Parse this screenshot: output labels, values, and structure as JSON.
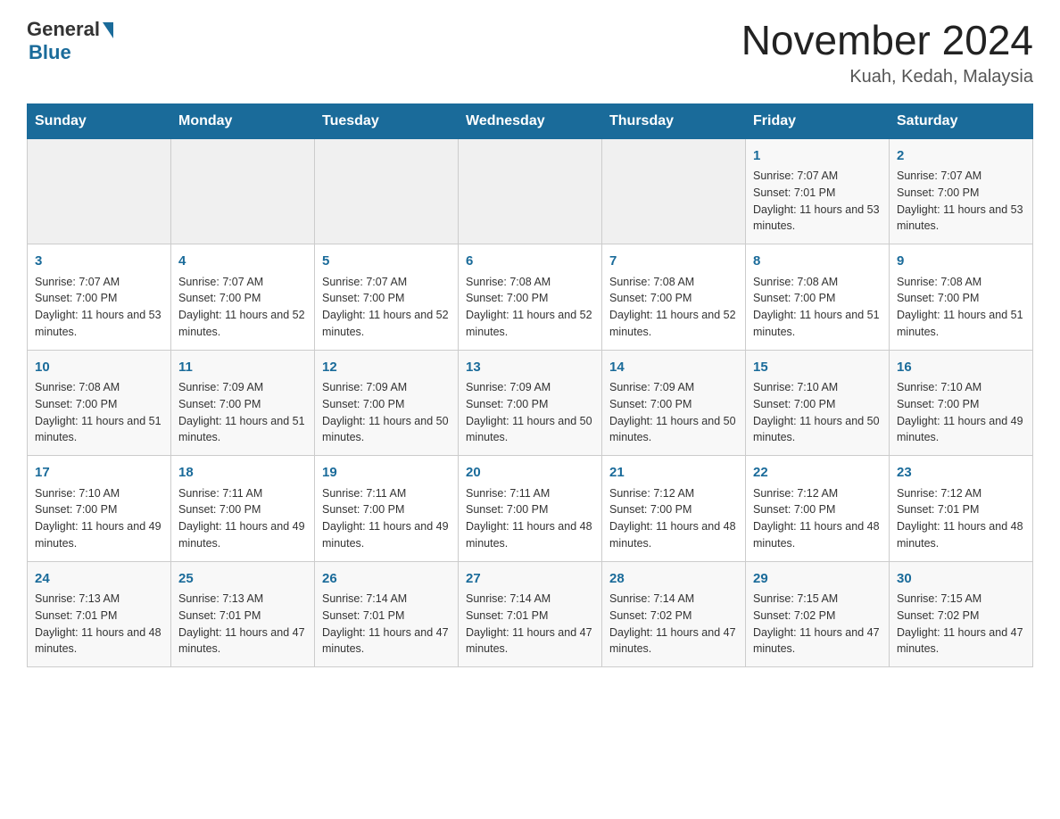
{
  "header": {
    "logo_general": "General",
    "logo_blue": "Blue",
    "month_title": "November 2024",
    "location": "Kuah, Kedah, Malaysia"
  },
  "days_of_week": [
    "Sunday",
    "Monday",
    "Tuesday",
    "Wednesday",
    "Thursday",
    "Friday",
    "Saturday"
  ],
  "weeks": [
    [
      {
        "day": "",
        "sunrise": "",
        "sunset": "",
        "daylight": ""
      },
      {
        "day": "",
        "sunrise": "",
        "sunset": "",
        "daylight": ""
      },
      {
        "day": "",
        "sunrise": "",
        "sunset": "",
        "daylight": ""
      },
      {
        "day": "",
        "sunrise": "",
        "sunset": "",
        "daylight": ""
      },
      {
        "day": "",
        "sunrise": "",
        "sunset": "",
        "daylight": ""
      },
      {
        "day": "1",
        "sunrise": "Sunrise: 7:07 AM",
        "sunset": "Sunset: 7:01 PM",
        "daylight": "Daylight: 11 hours and 53 minutes."
      },
      {
        "day": "2",
        "sunrise": "Sunrise: 7:07 AM",
        "sunset": "Sunset: 7:00 PM",
        "daylight": "Daylight: 11 hours and 53 minutes."
      }
    ],
    [
      {
        "day": "3",
        "sunrise": "Sunrise: 7:07 AM",
        "sunset": "Sunset: 7:00 PM",
        "daylight": "Daylight: 11 hours and 53 minutes."
      },
      {
        "day": "4",
        "sunrise": "Sunrise: 7:07 AM",
        "sunset": "Sunset: 7:00 PM",
        "daylight": "Daylight: 11 hours and 52 minutes."
      },
      {
        "day": "5",
        "sunrise": "Sunrise: 7:07 AM",
        "sunset": "Sunset: 7:00 PM",
        "daylight": "Daylight: 11 hours and 52 minutes."
      },
      {
        "day": "6",
        "sunrise": "Sunrise: 7:08 AM",
        "sunset": "Sunset: 7:00 PM",
        "daylight": "Daylight: 11 hours and 52 minutes."
      },
      {
        "day": "7",
        "sunrise": "Sunrise: 7:08 AM",
        "sunset": "Sunset: 7:00 PM",
        "daylight": "Daylight: 11 hours and 52 minutes."
      },
      {
        "day": "8",
        "sunrise": "Sunrise: 7:08 AM",
        "sunset": "Sunset: 7:00 PM",
        "daylight": "Daylight: 11 hours and 51 minutes."
      },
      {
        "day": "9",
        "sunrise": "Sunrise: 7:08 AM",
        "sunset": "Sunset: 7:00 PM",
        "daylight": "Daylight: 11 hours and 51 minutes."
      }
    ],
    [
      {
        "day": "10",
        "sunrise": "Sunrise: 7:08 AM",
        "sunset": "Sunset: 7:00 PM",
        "daylight": "Daylight: 11 hours and 51 minutes."
      },
      {
        "day": "11",
        "sunrise": "Sunrise: 7:09 AM",
        "sunset": "Sunset: 7:00 PM",
        "daylight": "Daylight: 11 hours and 51 minutes."
      },
      {
        "day": "12",
        "sunrise": "Sunrise: 7:09 AM",
        "sunset": "Sunset: 7:00 PM",
        "daylight": "Daylight: 11 hours and 50 minutes."
      },
      {
        "day": "13",
        "sunrise": "Sunrise: 7:09 AM",
        "sunset": "Sunset: 7:00 PM",
        "daylight": "Daylight: 11 hours and 50 minutes."
      },
      {
        "day": "14",
        "sunrise": "Sunrise: 7:09 AM",
        "sunset": "Sunset: 7:00 PM",
        "daylight": "Daylight: 11 hours and 50 minutes."
      },
      {
        "day": "15",
        "sunrise": "Sunrise: 7:10 AM",
        "sunset": "Sunset: 7:00 PM",
        "daylight": "Daylight: 11 hours and 50 minutes."
      },
      {
        "day": "16",
        "sunrise": "Sunrise: 7:10 AM",
        "sunset": "Sunset: 7:00 PM",
        "daylight": "Daylight: 11 hours and 49 minutes."
      }
    ],
    [
      {
        "day": "17",
        "sunrise": "Sunrise: 7:10 AM",
        "sunset": "Sunset: 7:00 PM",
        "daylight": "Daylight: 11 hours and 49 minutes."
      },
      {
        "day": "18",
        "sunrise": "Sunrise: 7:11 AM",
        "sunset": "Sunset: 7:00 PM",
        "daylight": "Daylight: 11 hours and 49 minutes."
      },
      {
        "day": "19",
        "sunrise": "Sunrise: 7:11 AM",
        "sunset": "Sunset: 7:00 PM",
        "daylight": "Daylight: 11 hours and 49 minutes."
      },
      {
        "day": "20",
        "sunrise": "Sunrise: 7:11 AM",
        "sunset": "Sunset: 7:00 PM",
        "daylight": "Daylight: 11 hours and 48 minutes."
      },
      {
        "day": "21",
        "sunrise": "Sunrise: 7:12 AM",
        "sunset": "Sunset: 7:00 PM",
        "daylight": "Daylight: 11 hours and 48 minutes."
      },
      {
        "day": "22",
        "sunrise": "Sunrise: 7:12 AM",
        "sunset": "Sunset: 7:00 PM",
        "daylight": "Daylight: 11 hours and 48 minutes."
      },
      {
        "day": "23",
        "sunrise": "Sunrise: 7:12 AM",
        "sunset": "Sunset: 7:01 PM",
        "daylight": "Daylight: 11 hours and 48 minutes."
      }
    ],
    [
      {
        "day": "24",
        "sunrise": "Sunrise: 7:13 AM",
        "sunset": "Sunset: 7:01 PM",
        "daylight": "Daylight: 11 hours and 48 minutes."
      },
      {
        "day": "25",
        "sunrise": "Sunrise: 7:13 AM",
        "sunset": "Sunset: 7:01 PM",
        "daylight": "Daylight: 11 hours and 47 minutes."
      },
      {
        "day": "26",
        "sunrise": "Sunrise: 7:14 AM",
        "sunset": "Sunset: 7:01 PM",
        "daylight": "Daylight: 11 hours and 47 minutes."
      },
      {
        "day": "27",
        "sunrise": "Sunrise: 7:14 AM",
        "sunset": "Sunset: 7:01 PM",
        "daylight": "Daylight: 11 hours and 47 minutes."
      },
      {
        "day": "28",
        "sunrise": "Sunrise: 7:14 AM",
        "sunset": "Sunset: 7:02 PM",
        "daylight": "Daylight: 11 hours and 47 minutes."
      },
      {
        "day": "29",
        "sunrise": "Sunrise: 7:15 AM",
        "sunset": "Sunset: 7:02 PM",
        "daylight": "Daylight: 11 hours and 47 minutes."
      },
      {
        "day": "30",
        "sunrise": "Sunrise: 7:15 AM",
        "sunset": "Sunset: 7:02 PM",
        "daylight": "Daylight: 11 hours and 47 minutes."
      }
    ]
  ]
}
